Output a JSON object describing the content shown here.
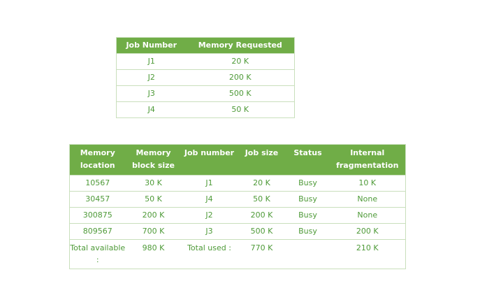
{
  "jobs_table": {
    "headers": [
      "Job Number",
      "Memory Requested"
    ],
    "rows": [
      [
        "J1",
        "20 K"
      ],
      [
        "J2",
        "200 K"
      ],
      [
        "J3",
        "500 K"
      ],
      [
        "J4",
        "50 K"
      ]
    ]
  },
  "memory_table": {
    "headers": [
      "Memory location",
      "Memory block size",
      "Job number",
      "Job size",
      "Status",
      "Internal fragmentation"
    ],
    "rows": [
      [
        "10567",
        "30 K",
        "J1",
        "20 K",
        "Busy",
        "10 K"
      ],
      [
        "30457",
        "50 K",
        "J4",
        "50 K",
        "Busy",
        "None"
      ],
      [
        "300875",
        "200 K",
        "J2",
        "200 K",
        "Busy",
        "None"
      ],
      [
        "809567",
        "700 K",
        "J3",
        "500 K",
        "Busy",
        "200 K"
      ]
    ],
    "total_row": [
      "Total available :",
      "980 K",
      "Total used :",
      "770 K",
      "",
      "210 K"
    ]
  },
  "colors": {
    "header_bg": "#70ad47",
    "header_text": "#ffffff",
    "cell_text": "#4e9a38",
    "border": "#c9dfbc"
  }
}
